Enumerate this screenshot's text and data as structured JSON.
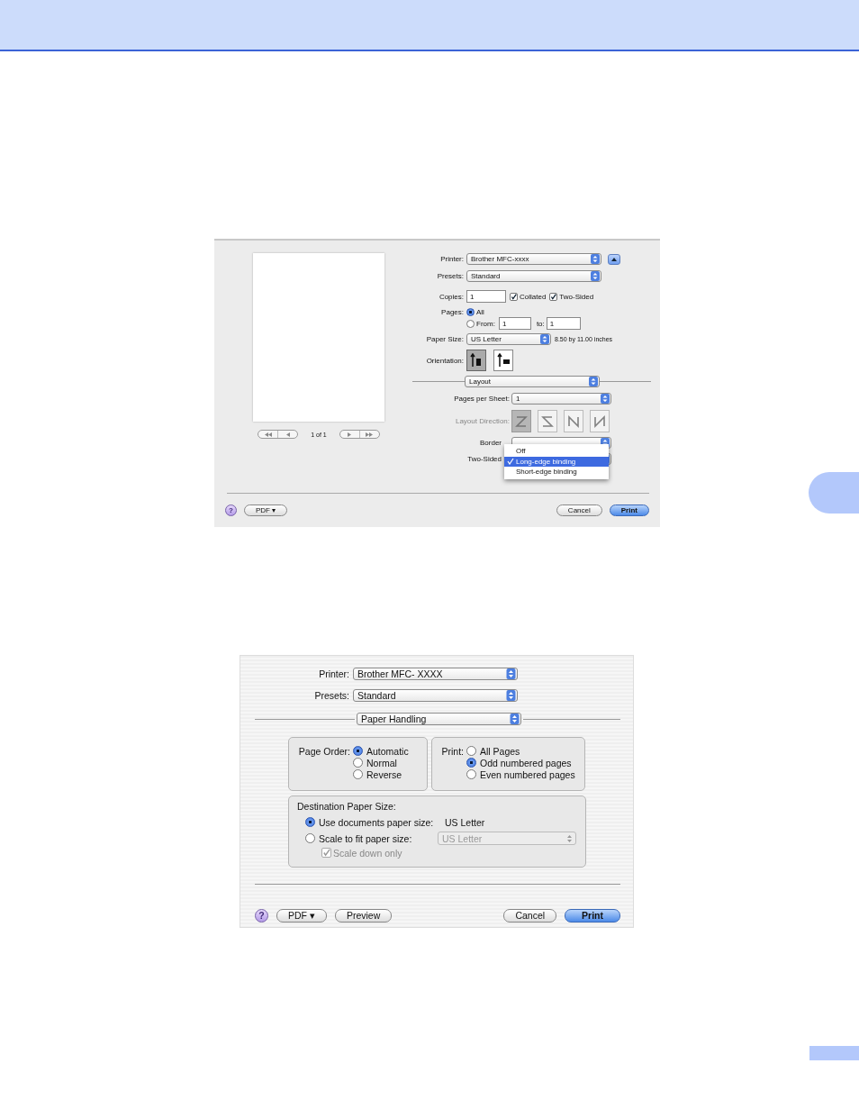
{
  "layout_dialog": {
    "preview": {
      "page_label": "1 of 1"
    },
    "printer": {
      "label": "Printer:",
      "value": "Brother MFC-xxxx"
    },
    "presets": {
      "label": "Presets:",
      "value": "Standard"
    },
    "copies": {
      "label": "Copies:",
      "value": "1"
    },
    "collated": {
      "label": "Collated",
      "checked": true
    },
    "two_sided": {
      "label": "Two-Sided",
      "checked": true
    },
    "pages": {
      "label": "Pages:",
      "options": [
        {
          "label": "All",
          "selected": true
        },
        {
          "label": "From:",
          "selected": false
        }
      ],
      "from": "1",
      "to_label": "to:",
      "to": "1"
    },
    "paper_size": {
      "label": "Paper Size:",
      "value": "US Letter",
      "note": "8.50 by 11.00 inches"
    },
    "orientation": {
      "label": "Orientation:",
      "options": [
        {
          "kind": "portrait",
          "selected": true
        },
        {
          "kind": "landscape",
          "selected": false
        }
      ]
    },
    "panel": {
      "value": "Layout"
    },
    "pages_per_sheet": {
      "label": "Pages per Sheet:",
      "value": "1"
    },
    "layout_direction": {
      "label": "Layout Direction:",
      "disabled": true,
      "options": [
        {
          "kind": "z",
          "selected": true
        },
        {
          "kind": "s",
          "selected": false
        },
        {
          "kind": "n-reverse",
          "selected": false
        },
        {
          "kind": "n",
          "selected": false
        }
      ]
    },
    "border": {
      "label": "Border"
    },
    "two_sided_binding": {
      "label": "Two-Sided"
    },
    "menu": [
      {
        "label": "Off",
        "selected": false
      },
      {
        "label": "Long-edge binding",
        "selected": true
      },
      {
        "label": "Short-edge binding",
        "selected": false
      }
    ],
    "left_buttons": [
      {
        "kind": "help",
        "label": "?"
      },
      {
        "kind": "normal",
        "label": "PDF ▾"
      }
    ],
    "right_buttons": [
      {
        "kind": "normal",
        "label": "Cancel"
      },
      {
        "kind": "default",
        "label": "Print"
      }
    ]
  },
  "paper_handling_dialog": {
    "printer": {
      "label": "Printer:",
      "value": "Brother MFC- XXXX"
    },
    "presets": {
      "label": "Presets:",
      "value": "Standard"
    },
    "panel": {
      "value": "Paper Handling"
    },
    "page_order": {
      "label": "Page Order:",
      "options": [
        {
          "label": "Automatic",
          "selected": true
        },
        {
          "label": "Normal",
          "selected": false
        },
        {
          "label": "Reverse",
          "selected": false
        }
      ]
    },
    "print": {
      "label": "Print:",
      "options": [
        {
          "label": "All Pages",
          "selected": false
        },
        {
          "label": "Odd numbered pages",
          "selected": true
        },
        {
          "label": "Even numbered pages",
          "selected": false
        }
      ]
    },
    "destination": {
      "title": "Destination Paper Size:",
      "options": [
        {
          "label": "Use documents paper size:",
          "selected": true
        },
        {
          "label": "Scale to fit paper size:",
          "selected": false
        }
      ],
      "document_size": "US Letter",
      "scale_size": {
        "value": "US Letter",
        "disabled": true
      },
      "scale_down": {
        "label": "Scale down only",
        "checked": true,
        "disabled": true
      }
    },
    "left_buttons": [
      {
        "kind": "help",
        "label": "?"
      },
      {
        "kind": "normal",
        "label": "PDF ▾"
      },
      {
        "kind": "normal",
        "label": "Preview"
      }
    ],
    "right_buttons": [
      {
        "kind": "normal",
        "label": "Cancel"
      },
      {
        "kind": "default",
        "label": "Print"
      }
    ]
  }
}
